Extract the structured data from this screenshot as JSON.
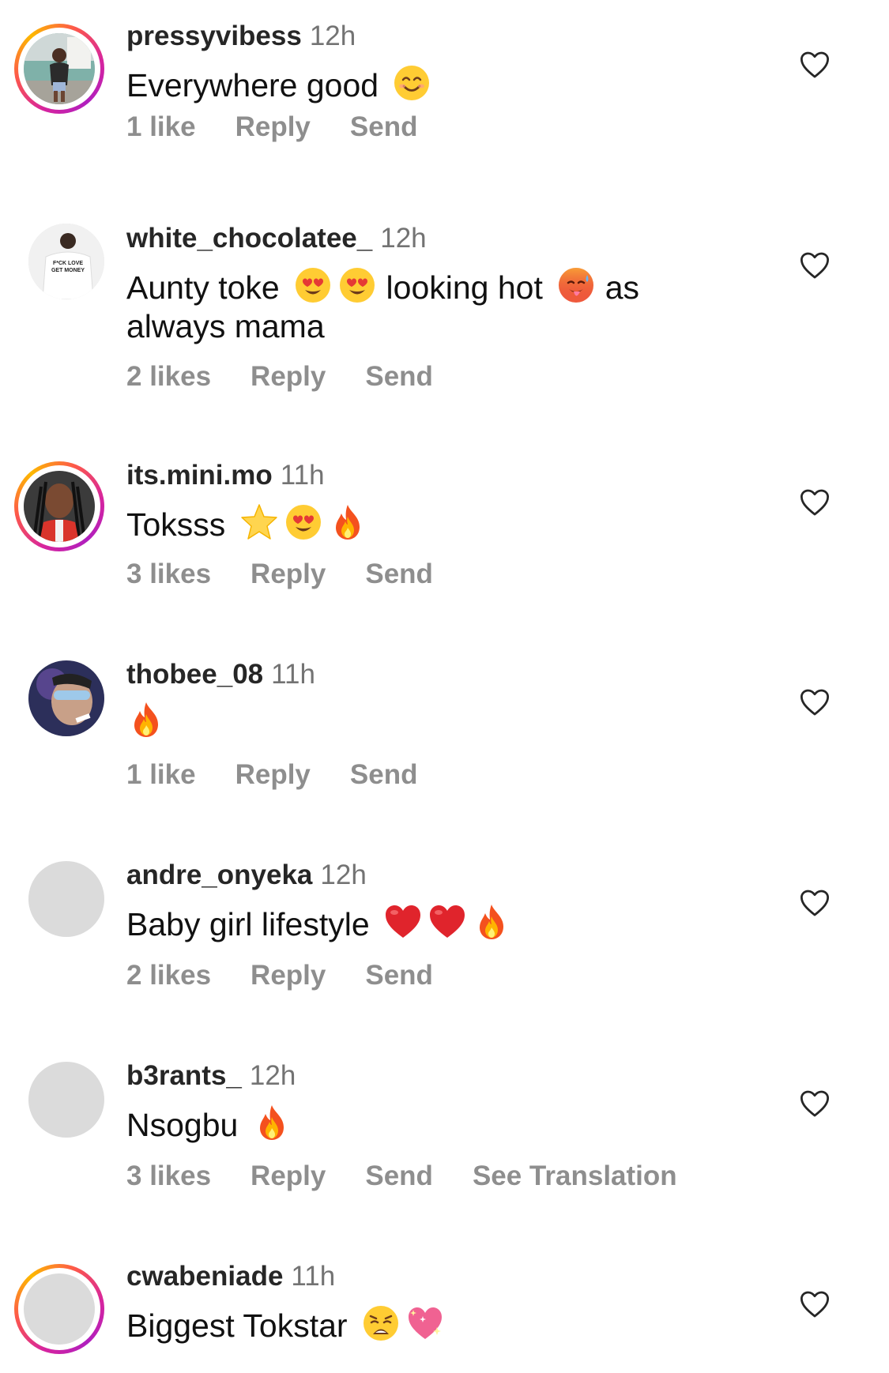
{
  "comments": [
    {
      "username": "pressyvibess",
      "time": "12h",
      "text": "Everywhere good",
      "emojis": [
        "smiling-face-with-smiling-eyes"
      ],
      "likes": "1 like",
      "reply": "Reply",
      "send": "Send",
      "story_ring": true
    },
    {
      "username": "white_chocolatee_",
      "time": "12h",
      "text_part1": "Aunty toke",
      "text_part2": "looking hot",
      "text_part3": "as",
      "text_line2": "always mama",
      "emojis": [
        "heart-eyes",
        "heart-eyes",
        "hot-face"
      ],
      "likes": "2 likes",
      "reply": "Reply",
      "send": "Send",
      "avatar_text_1": "F*CK LOVE",
      "avatar_text_2": "GET MONEY"
    },
    {
      "username": "its.mini.mo",
      "time": "11h",
      "text": "Toksss",
      "emojis": [
        "star",
        "heart-eyes",
        "fire"
      ],
      "likes": "3 likes",
      "reply": "Reply",
      "send": "Send",
      "story_ring": true
    },
    {
      "username": "thobee_08",
      "time": "11h",
      "text": "",
      "emojis": [
        "fire"
      ],
      "likes": "1 like",
      "reply": "Reply",
      "send": "Send"
    },
    {
      "username": "andre_onyeka",
      "time": "12h",
      "text": "Baby girl lifestyle",
      "emojis": [
        "red-heart",
        "red-heart",
        "fire"
      ],
      "likes": "2 likes",
      "reply": "Reply",
      "send": "Send"
    },
    {
      "username": "b3rants_",
      "time": "12h",
      "text": "Nsogbu",
      "emojis": [
        "fire"
      ],
      "likes": "3 likes",
      "reply": "Reply",
      "send": "Send",
      "see_translation": "See Translation"
    },
    {
      "username": "cwabeniade",
      "time": "11h",
      "text": "Biggest Tokstar",
      "emojis": [
        "weary-face",
        "sparkling-heart"
      ],
      "story_ring": true
    }
  ],
  "colors": {
    "username": "#262626",
    "secondary": "#8e8e8e",
    "placeholder_avatar": "#dbdbdb",
    "ring_gradient": [
      "#d6249f",
      "#fd5949",
      "#fdb900"
    ]
  }
}
